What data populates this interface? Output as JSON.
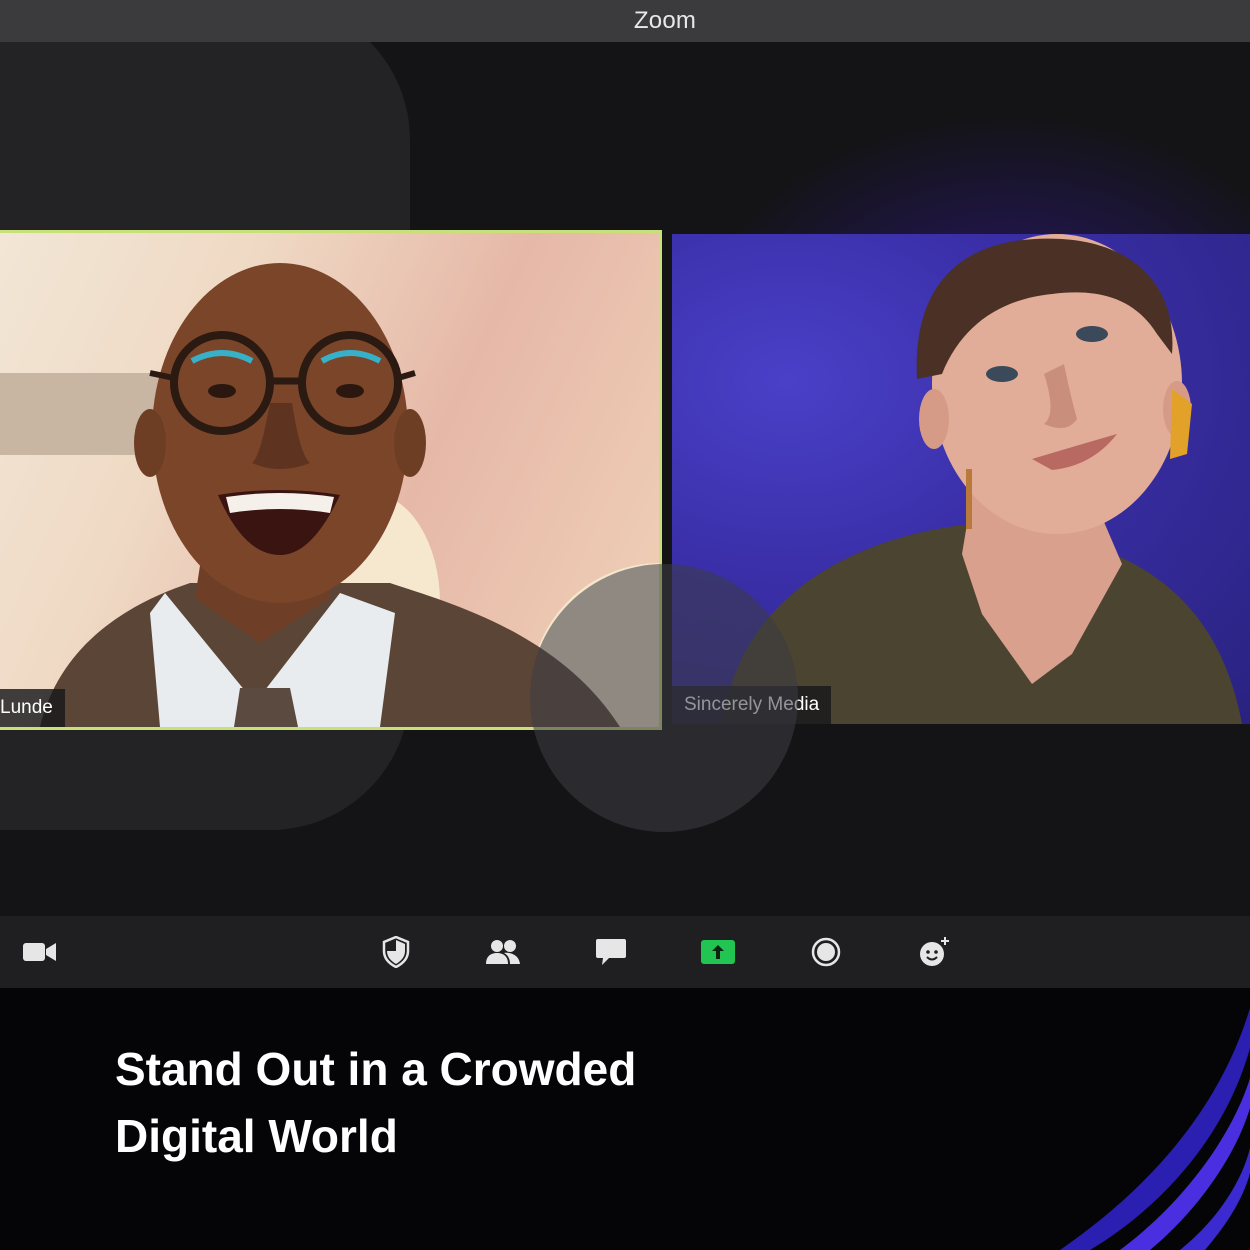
{
  "window": {
    "title": "Zoom"
  },
  "participants": [
    {
      "name": "Lunde",
      "active_speaker": true
    },
    {
      "name": "Sincerely Media",
      "active_speaker": false
    }
  ],
  "toolbar": {
    "buttons": [
      {
        "icon": "video-camera-icon"
      },
      {
        "icon": "security-shield-icon"
      },
      {
        "icon": "participants-icon"
      },
      {
        "icon": "chat-icon"
      },
      {
        "icon": "share-screen-icon",
        "accent": "#23c552"
      },
      {
        "icon": "record-icon"
      },
      {
        "icon": "reactions-icon"
      }
    ]
  },
  "headline": {
    "line1": "Stand Out in a Crowded",
    "line2": "Digital World"
  },
  "colors": {
    "active_speaker_border": "#c8e07a",
    "share_green": "#23c552",
    "accent_purple": "#4a2fe0"
  }
}
